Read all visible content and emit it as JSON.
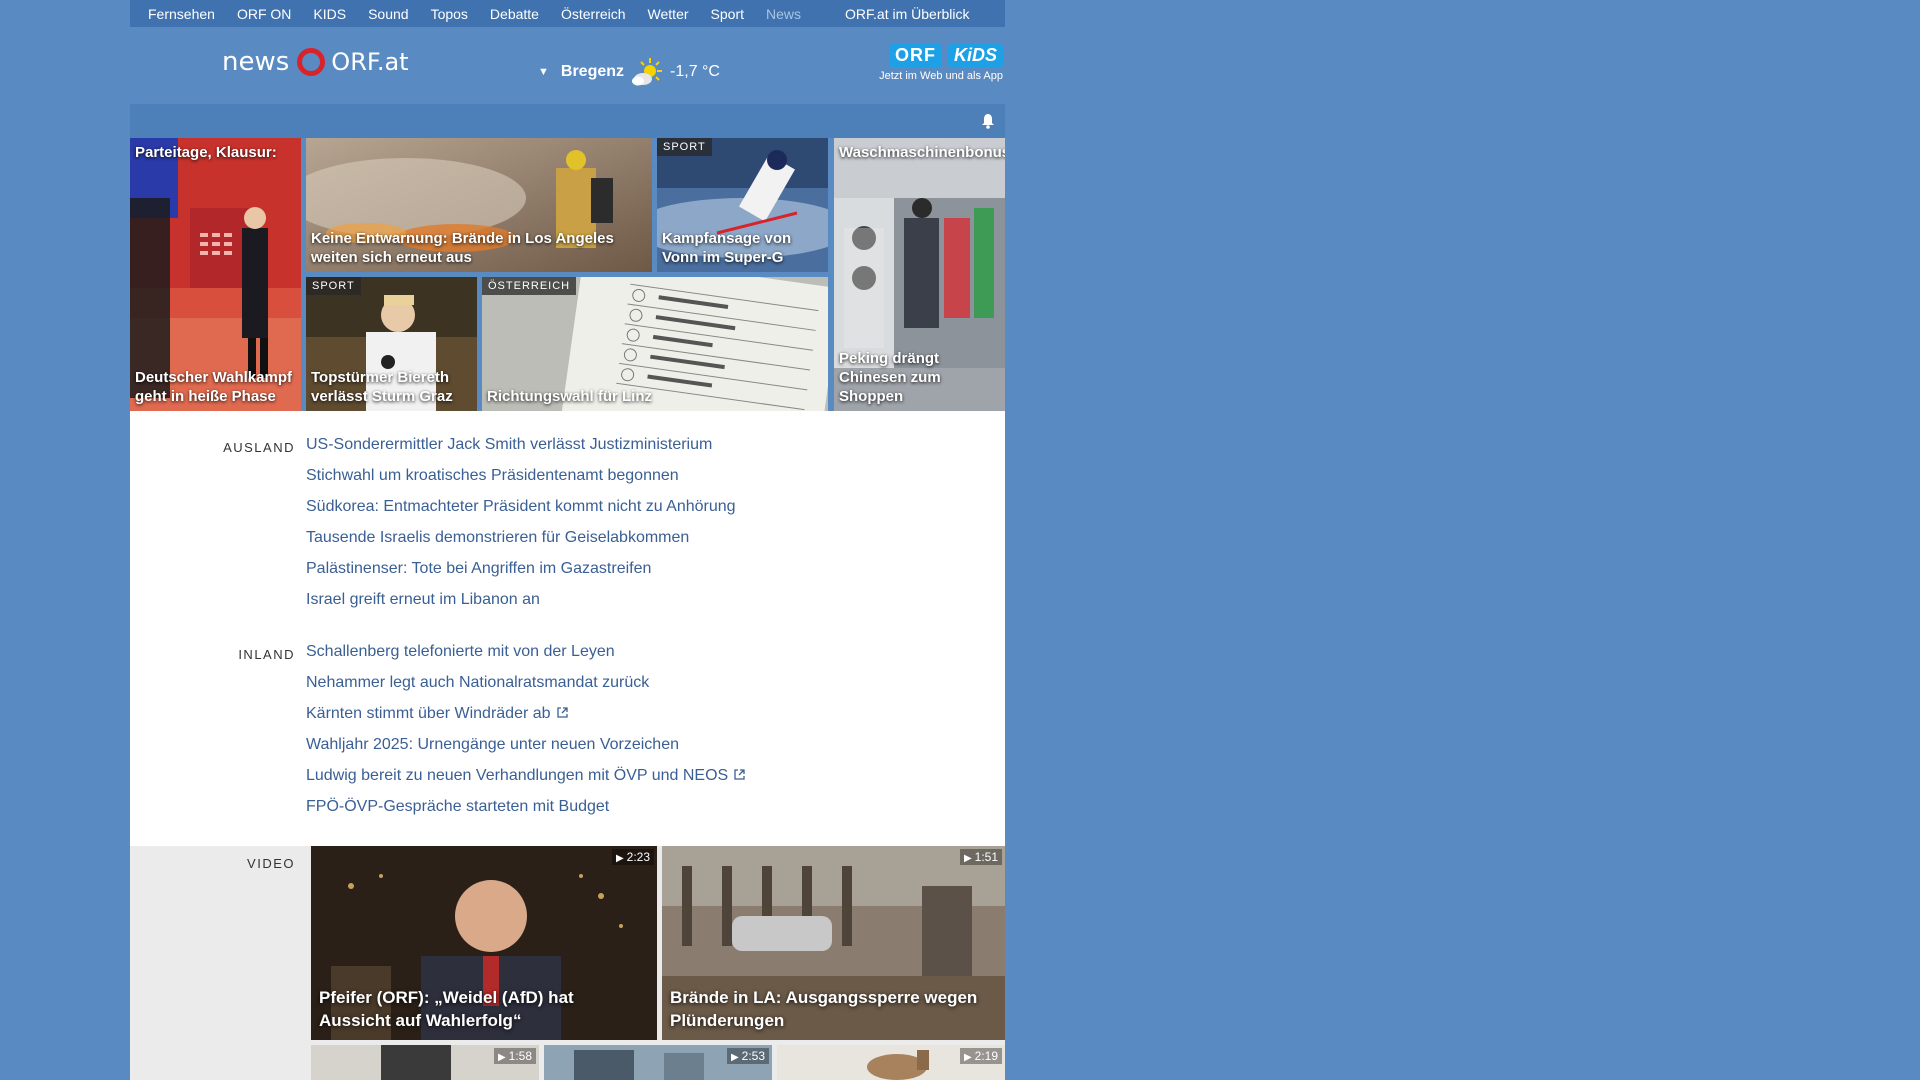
{
  "topnav": {
    "items": [
      "Fernsehen",
      "ORF ON",
      "KIDS",
      "Sound",
      "Topos",
      "Debatte",
      "Österreich",
      "Wetter",
      "Sport",
      "News"
    ],
    "overview": "ORF.at im Überblick"
  },
  "header": {
    "logo_left": "news",
    "logo_right": "ORF.at",
    "weather": {
      "city": "Bregenz",
      "temp": "-1,7 °C",
      "icon": "sun-cloud-icon"
    },
    "kids": {
      "orf": "ORF",
      "kids": "KiDS",
      "tagline": "Jetzt im Web und als App"
    }
  },
  "tiles": [
    {
      "topcap": "Parteitage, Klausur:",
      "caption": "Deutscher Wahlkampf geht in heiße Phase",
      "color": "#c8322c"
    },
    {
      "caption": "Keine Entwarnung: Brände in Los Angeles weiten sich erneut aus",
      "color": "#8a6b54"
    },
    {
      "badge": "SPORT",
      "caption": "Kampfansage von Vonn im Super-G",
      "color": "#3a5e8a"
    },
    {
      "topcap": "Waschmaschinenbonus:",
      "caption": "Peking drängt Chinesen zum Shoppen",
      "color": "#6e7580"
    },
    {
      "badge": "SPORT",
      "caption": "Topstürmer Biereth verlässt Sturm Graz",
      "color": "#6b5a3e"
    },
    {
      "badge": "ÖSTERREICH",
      "caption": "Richtungswahl für Linz",
      "color": "#c9c9c4"
    }
  ],
  "ausland": {
    "label": "AUSLAND",
    "items": [
      "US-Sonderermittler Jack Smith verlässt Justizministerium",
      "Stichwahl um kroatisches Präsidentenamt begonnen",
      "Südkorea: Entmachteter Präsident kommt nicht zu Anhörung",
      "Tausende Israelis demonstrieren für Geiselabkommen",
      "Palästinenser: Tote bei Angriffen im Gazastreifen",
      "Israel greift erneut im Libanon an"
    ]
  },
  "inland": {
    "label": "INLAND",
    "items": [
      "Schallenberg telefonierte mit von der Leyen",
      "Nehammer legt auch Nationalratsmandat zurück",
      "Kärnten stimmt über Windräder ab",
      "Wahljahr 2025: Urnengänge unter neuen Vorzeichen",
      "Ludwig bereit zu neuen Verhandlungen mit ÖVP und NEOS",
      "FPÖ-ÖVP-Gespräche starteten mit Budget"
    ]
  },
  "video": {
    "label": "VIDEO",
    "items": [
      {
        "duration": "2:23",
        "caption": "Pfeifer (ORF): „Weidel (AfD) hat Aussicht auf Wahlerfolg“"
      },
      {
        "duration": "1:51",
        "caption": "Brände in LA: Ausgangssperre wegen Plünderungen"
      },
      {
        "duration": "1:58"
      },
      {
        "duration": "2:53"
      },
      {
        "duration": "2:19"
      }
    ]
  }
}
